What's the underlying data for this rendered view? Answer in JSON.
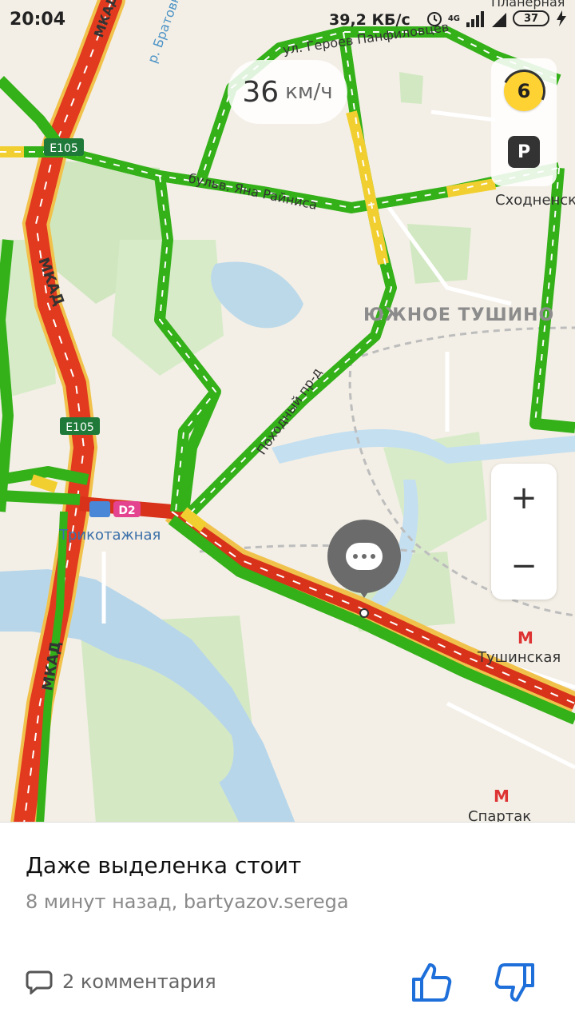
{
  "status_bar": {
    "time": "20:04",
    "net_speed": "39,2 КБ/с",
    "network": "4G",
    "battery": "37"
  },
  "map": {
    "speed_value": "36",
    "speed_unit": "км/ч",
    "traffic_level": "6",
    "parking_label": "P",
    "zoom_in": "+",
    "zoom_out": "−",
    "labels": {
      "mkad_top": "МКАД",
      "mkad_mid": "МКАД",
      "mkad_bottom": "МКАД",
      "e105_top": "E105",
      "e105_mid": "E105",
      "river": "р. Братовка",
      "street_geroev": "ул. Героев Панфиловцев",
      "street_rainisa": "бульв. Яна Райниса",
      "street_pohodny": "Походный пр-д",
      "district": "ЮЖНОЕ ТУШИНО",
      "station_trikotazhnaya": "Трикотажная",
      "d2": "D2",
      "metro_skhodnenskaya": "Сходненская",
      "metro_tushinskaya": "Тушинская",
      "metro_spartak": "Спартак",
      "planernaya": "Планерная"
    }
  },
  "card": {
    "title": "Даже выделенка стоит",
    "meta": "8 минут назад, bartyazov.serega",
    "comments": "2 комментария"
  }
}
